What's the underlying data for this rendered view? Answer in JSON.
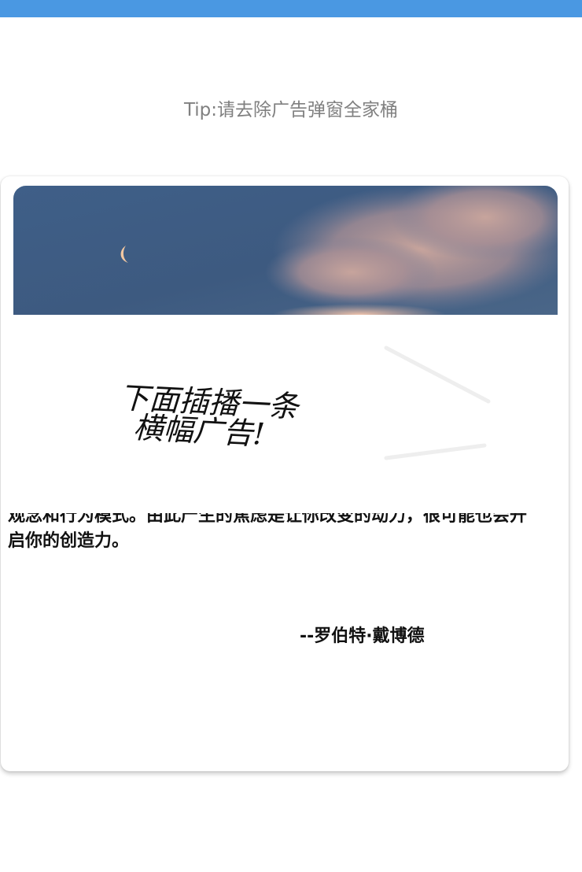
{
  "status_bar": {
    "color": "#4a98e2"
  },
  "tip": {
    "text": "Tip:请去除广告弹窗全家桶"
  },
  "card": {
    "image": {
      "description_icon": "moon-sky-image"
    },
    "banner_ad": {
      "line1": "下面插播一条",
      "line2": "横幅广告!"
    },
    "quote": {
      "partial_line": "观念和行为模式。由此产生的焦虑是让你改变的动力，很可能也会开",
      "last_line": "启你的创造力。",
      "author": "--罗伯特·戴博德"
    }
  }
}
